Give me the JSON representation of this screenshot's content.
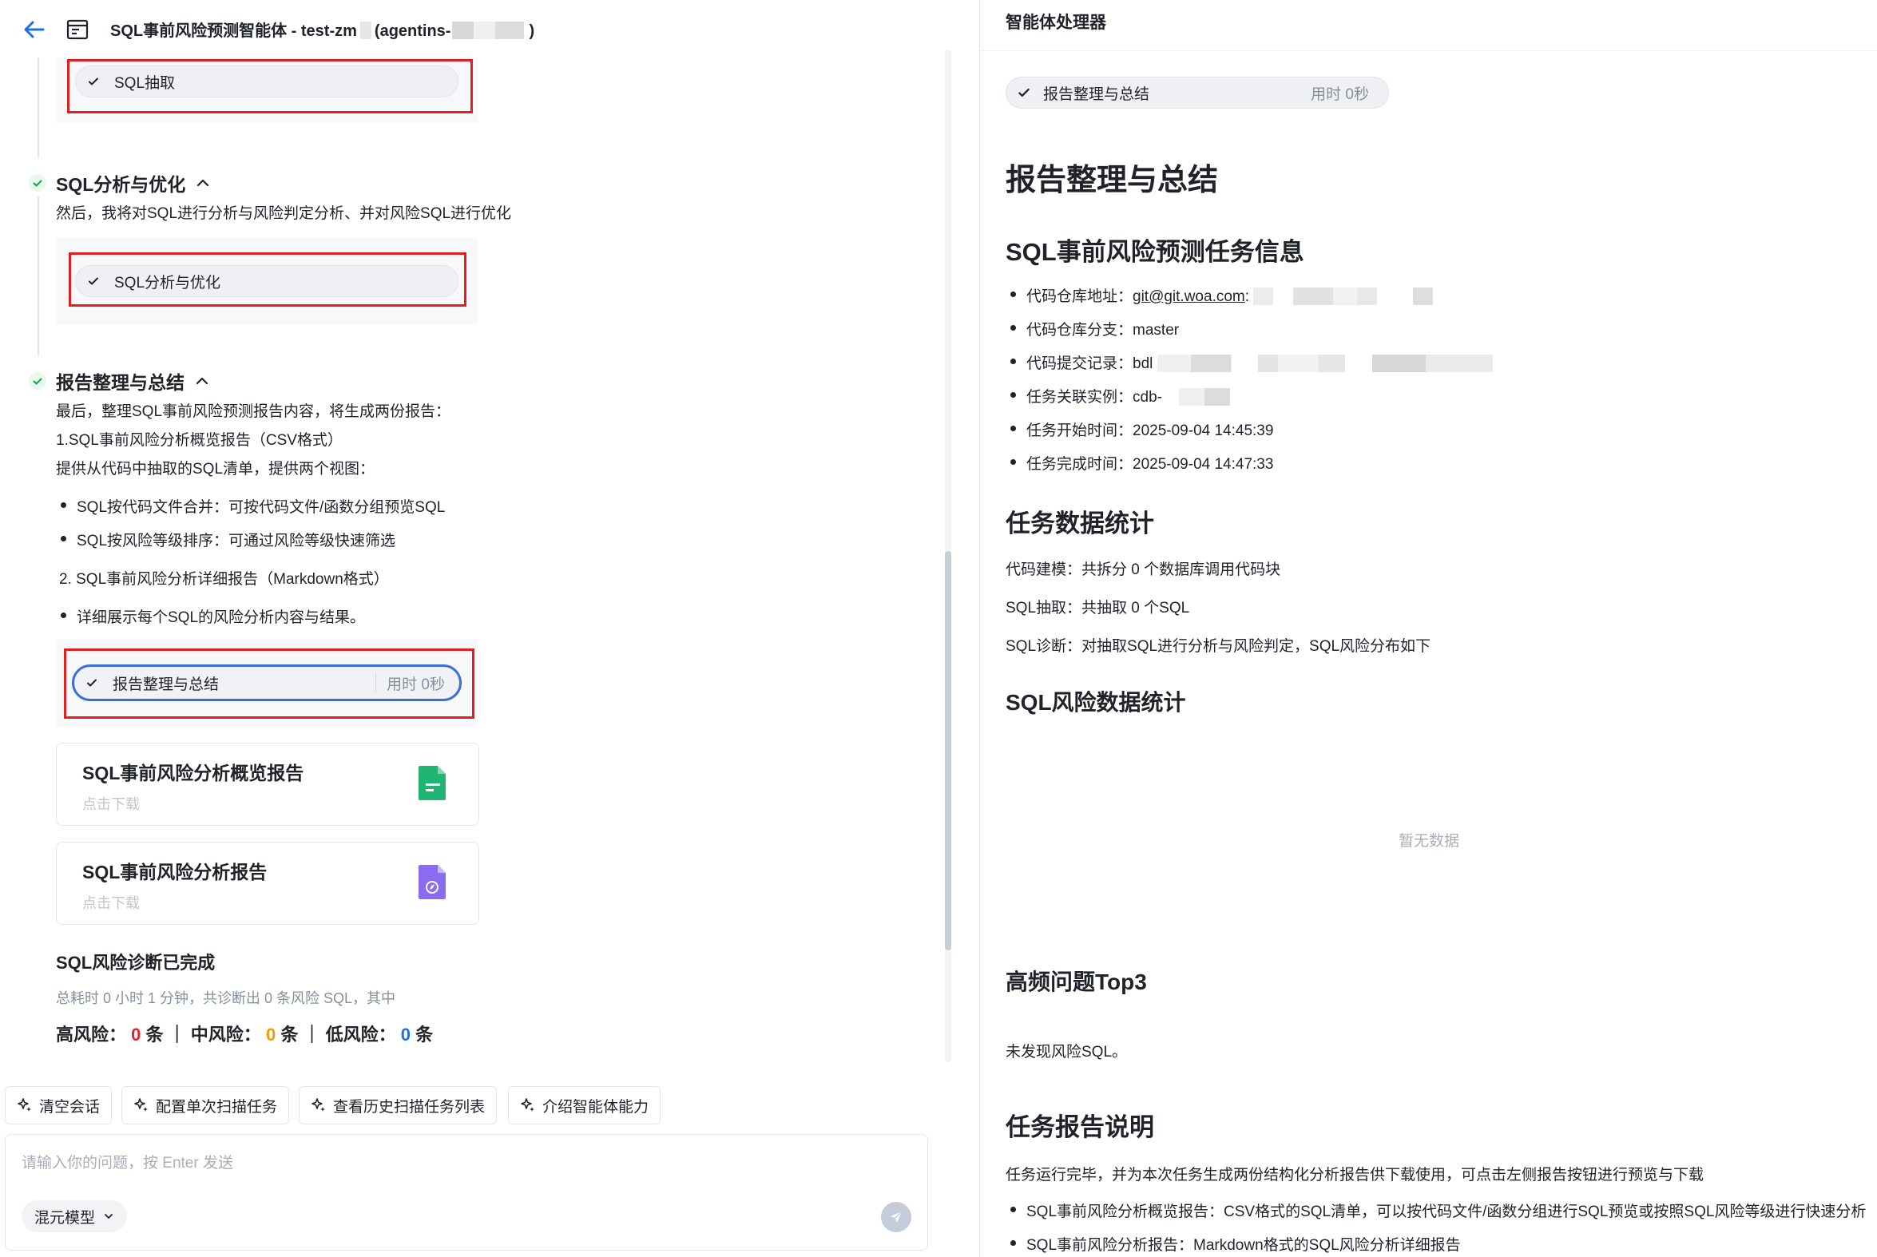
{
  "header": {
    "title_prefix": "SQL事前风险预测智能体 - test-zm",
    "title_mid": "(agentins-",
    "title_suffix": ")"
  },
  "steps": {
    "extract": {
      "tool_label": "SQL抽取"
    },
    "analyze": {
      "title": "SQL分析与优化",
      "desc": "然后，我将对SQL进行分析与风险判定分析、并对风险SQL进行优化",
      "tool_label": "SQL分析与优化"
    },
    "report": {
      "title": "报告整理与总结",
      "line1": "最后，整理SQL事前风险预测报告内容，将生成两份报告：",
      "line2": "1.SQL事前风险分析概览报告（CSV格式）",
      "line3": "提供从代码中抽取的SQL清单，提供两个视图：",
      "bullet1": "SQL按代码文件合并：可按代码文件/函数分组预览SQL",
      "bullet2": "SQL按风险等级排序：可通过风险等级快速筛选",
      "line4": "2. SQL事前风险分析详细报告（Markdown格式）",
      "bullet3": "详细展示每个SQL的风险分析内容与结果。",
      "tool_label": "报告整理与总结",
      "tool_time": "用时 0秒"
    }
  },
  "cards": [
    {
      "title": "SQL事前风险分析概览报告",
      "sub": "点击下载"
    },
    {
      "title": "SQL事前风险分析报告",
      "sub": "点击下载"
    }
  ],
  "summary": {
    "title": "SQL风险诊断已完成",
    "sub": "总耗时 0 小时 1 分钟，共诊断出 0 条风险 SQL，其中",
    "high_label": "高风险：",
    "high_count": "0",
    "mid_label": "中风险：",
    "mid_count": "0",
    "low_label": "低风险：",
    "low_count": "0",
    "unit": "条",
    "sep": "｜"
  },
  "quick_actions": [
    "清空会话",
    "配置单次扫描任务",
    "查看历史扫描任务列表",
    "介绍智能体能力"
  ],
  "input": {
    "placeholder": "请输入你的问题，按 Enter 发送",
    "model": "混元模型"
  },
  "right": {
    "title": "智能体处理器",
    "pill_label": "报告整理与总结",
    "pill_time": "用时 0秒",
    "h1": "报告整理与总结",
    "info_title": "SQL事前风险预测任务信息",
    "info": {
      "repo_label": "代码仓库地址：",
      "repo_value": "git@git.woa.com",
      "repo_tail": ":",
      "branch_label": "代码仓库分支：",
      "branch_value": "master",
      "commit_label": "代码提交记录：",
      "commit_value": "bdl",
      "instance_label": "任务关联实例：",
      "instance_value": "cdb-",
      "start_label": "任务开始时间：",
      "start_value": "2025-09-04 14:45:39",
      "end_label": "任务完成时间：",
      "end_value": "2025-09-04 14:47:33"
    },
    "stats_title": "任务数据统计",
    "stats": {
      "model": "代码建模：共拆分 0 个数据库调用代码块",
      "extract": "SQL抽取：共抽取 0 个SQL",
      "diagnose": "SQL诊断：对抽取SQL进行分析与风险判定，SQL风险分布如下"
    },
    "risk_stats_title": "SQL风险数据统计",
    "empty": "暂无数据",
    "top3_title": "高频问题Top3",
    "top3_text": "未发现风险SQL。",
    "report_title": "任务报告说明",
    "report_text": "任务运行完毕，并为本次任务生成两份结构化分析报告供下载使用，可点击左侧报告按钮进行预览与下载",
    "report_bullet1": "SQL事前风险分析概览报告：CSV格式的SQL清单，可以按代码文件/函数分组进行SQL预览或按照SQL风险等级进行快速分析",
    "report_bullet2": "SQL事前风险分析报告：Markdown格式的SQL风险分析详细报告"
  },
  "colors": {
    "accent": "#3d6fd8",
    "highlight_box": "#e02020",
    "check": "#1aa34a",
    "high": "#e0202f",
    "mid": "#f59a00",
    "low": "#1f6fe5"
  }
}
